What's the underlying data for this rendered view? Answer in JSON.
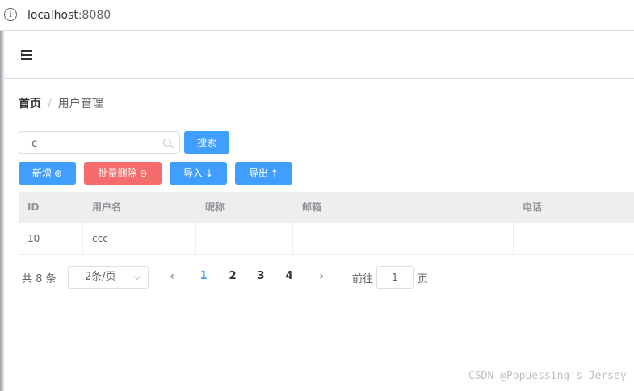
{
  "browser": {
    "info_glyph": "i",
    "url_host": "localhost",
    "url_port": ":8080"
  },
  "breadcrumb": {
    "home": "首页",
    "separator": "/",
    "current": "用户管理"
  },
  "search": {
    "value": "c",
    "button_label": "搜索"
  },
  "toolbar": {
    "add_label": "新增",
    "batch_delete_label": "批量删除",
    "import_label": "导入",
    "export_label": "导出"
  },
  "icons": {
    "add": "⊕",
    "batch_delete": "⊖",
    "import": "↓",
    "export": "↑"
  },
  "table": {
    "columns": [
      "ID",
      "用户名",
      "昵称",
      "邮箱",
      "电话"
    ],
    "rows": [
      [
        "10",
        "ccc",
        "",
        "",
        ""
      ]
    ]
  },
  "pagination": {
    "total": "共 8 条",
    "page_size": "2条/页",
    "prev": "‹",
    "next": "›",
    "pages": [
      "1",
      "2",
      "3",
      "4"
    ],
    "current_page": "1",
    "goto_label": "前往",
    "goto_value": "1",
    "page_suffix": "页"
  },
  "watermark": "CSDN @Popuessing's Jersey",
  "colors": {
    "primary": "#409eff",
    "danger": "#f56c6c",
    "header_bg": "#eeeeee"
  }
}
